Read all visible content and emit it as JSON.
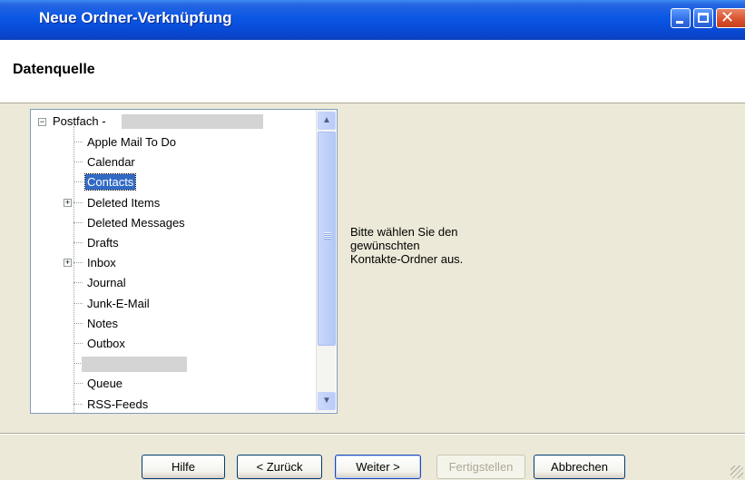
{
  "window": {
    "title": "Neue Ordner-Verknüpfung"
  },
  "header": {
    "title": "Datenquelle"
  },
  "tree": {
    "root_label": "Postfach -",
    "items": [
      {
        "label": "Apple Mail To Do",
        "expandable": false
      },
      {
        "label": "Calendar",
        "expandable": false
      },
      {
        "label": "Contacts",
        "expandable": false,
        "selected": true
      },
      {
        "label": "Deleted Items",
        "expandable": true
      },
      {
        "label": "Deleted Messages",
        "expandable": false
      },
      {
        "label": "Drafts",
        "expandable": false
      },
      {
        "label": "Inbox",
        "expandable": true
      },
      {
        "label": "Journal",
        "expandable": false
      },
      {
        "label": "Junk-E-Mail",
        "expandable": false
      },
      {
        "label": "Notes",
        "expandable": false
      },
      {
        "label": "Outbox",
        "expandable": false
      },
      {
        "label": "",
        "expandable": false,
        "redacted": true
      },
      {
        "label": "Queue",
        "expandable": false
      },
      {
        "label": "RSS-Feeds",
        "expandable": false
      }
    ]
  },
  "info": {
    "line1": "Bitte wählen Sie den",
    "line2": "gewünschten",
    "line3": "Kontakte-Ordner aus."
  },
  "buttons": {
    "help": "Hilfe",
    "back": "< Zurück",
    "next": "Weiter >",
    "finish": "Fertigstellen",
    "cancel": "Abbrechen"
  },
  "colors": {
    "titlebar": "#0a57e6",
    "selection": "#316ac5",
    "dialog_bg": "#ece9d8"
  }
}
